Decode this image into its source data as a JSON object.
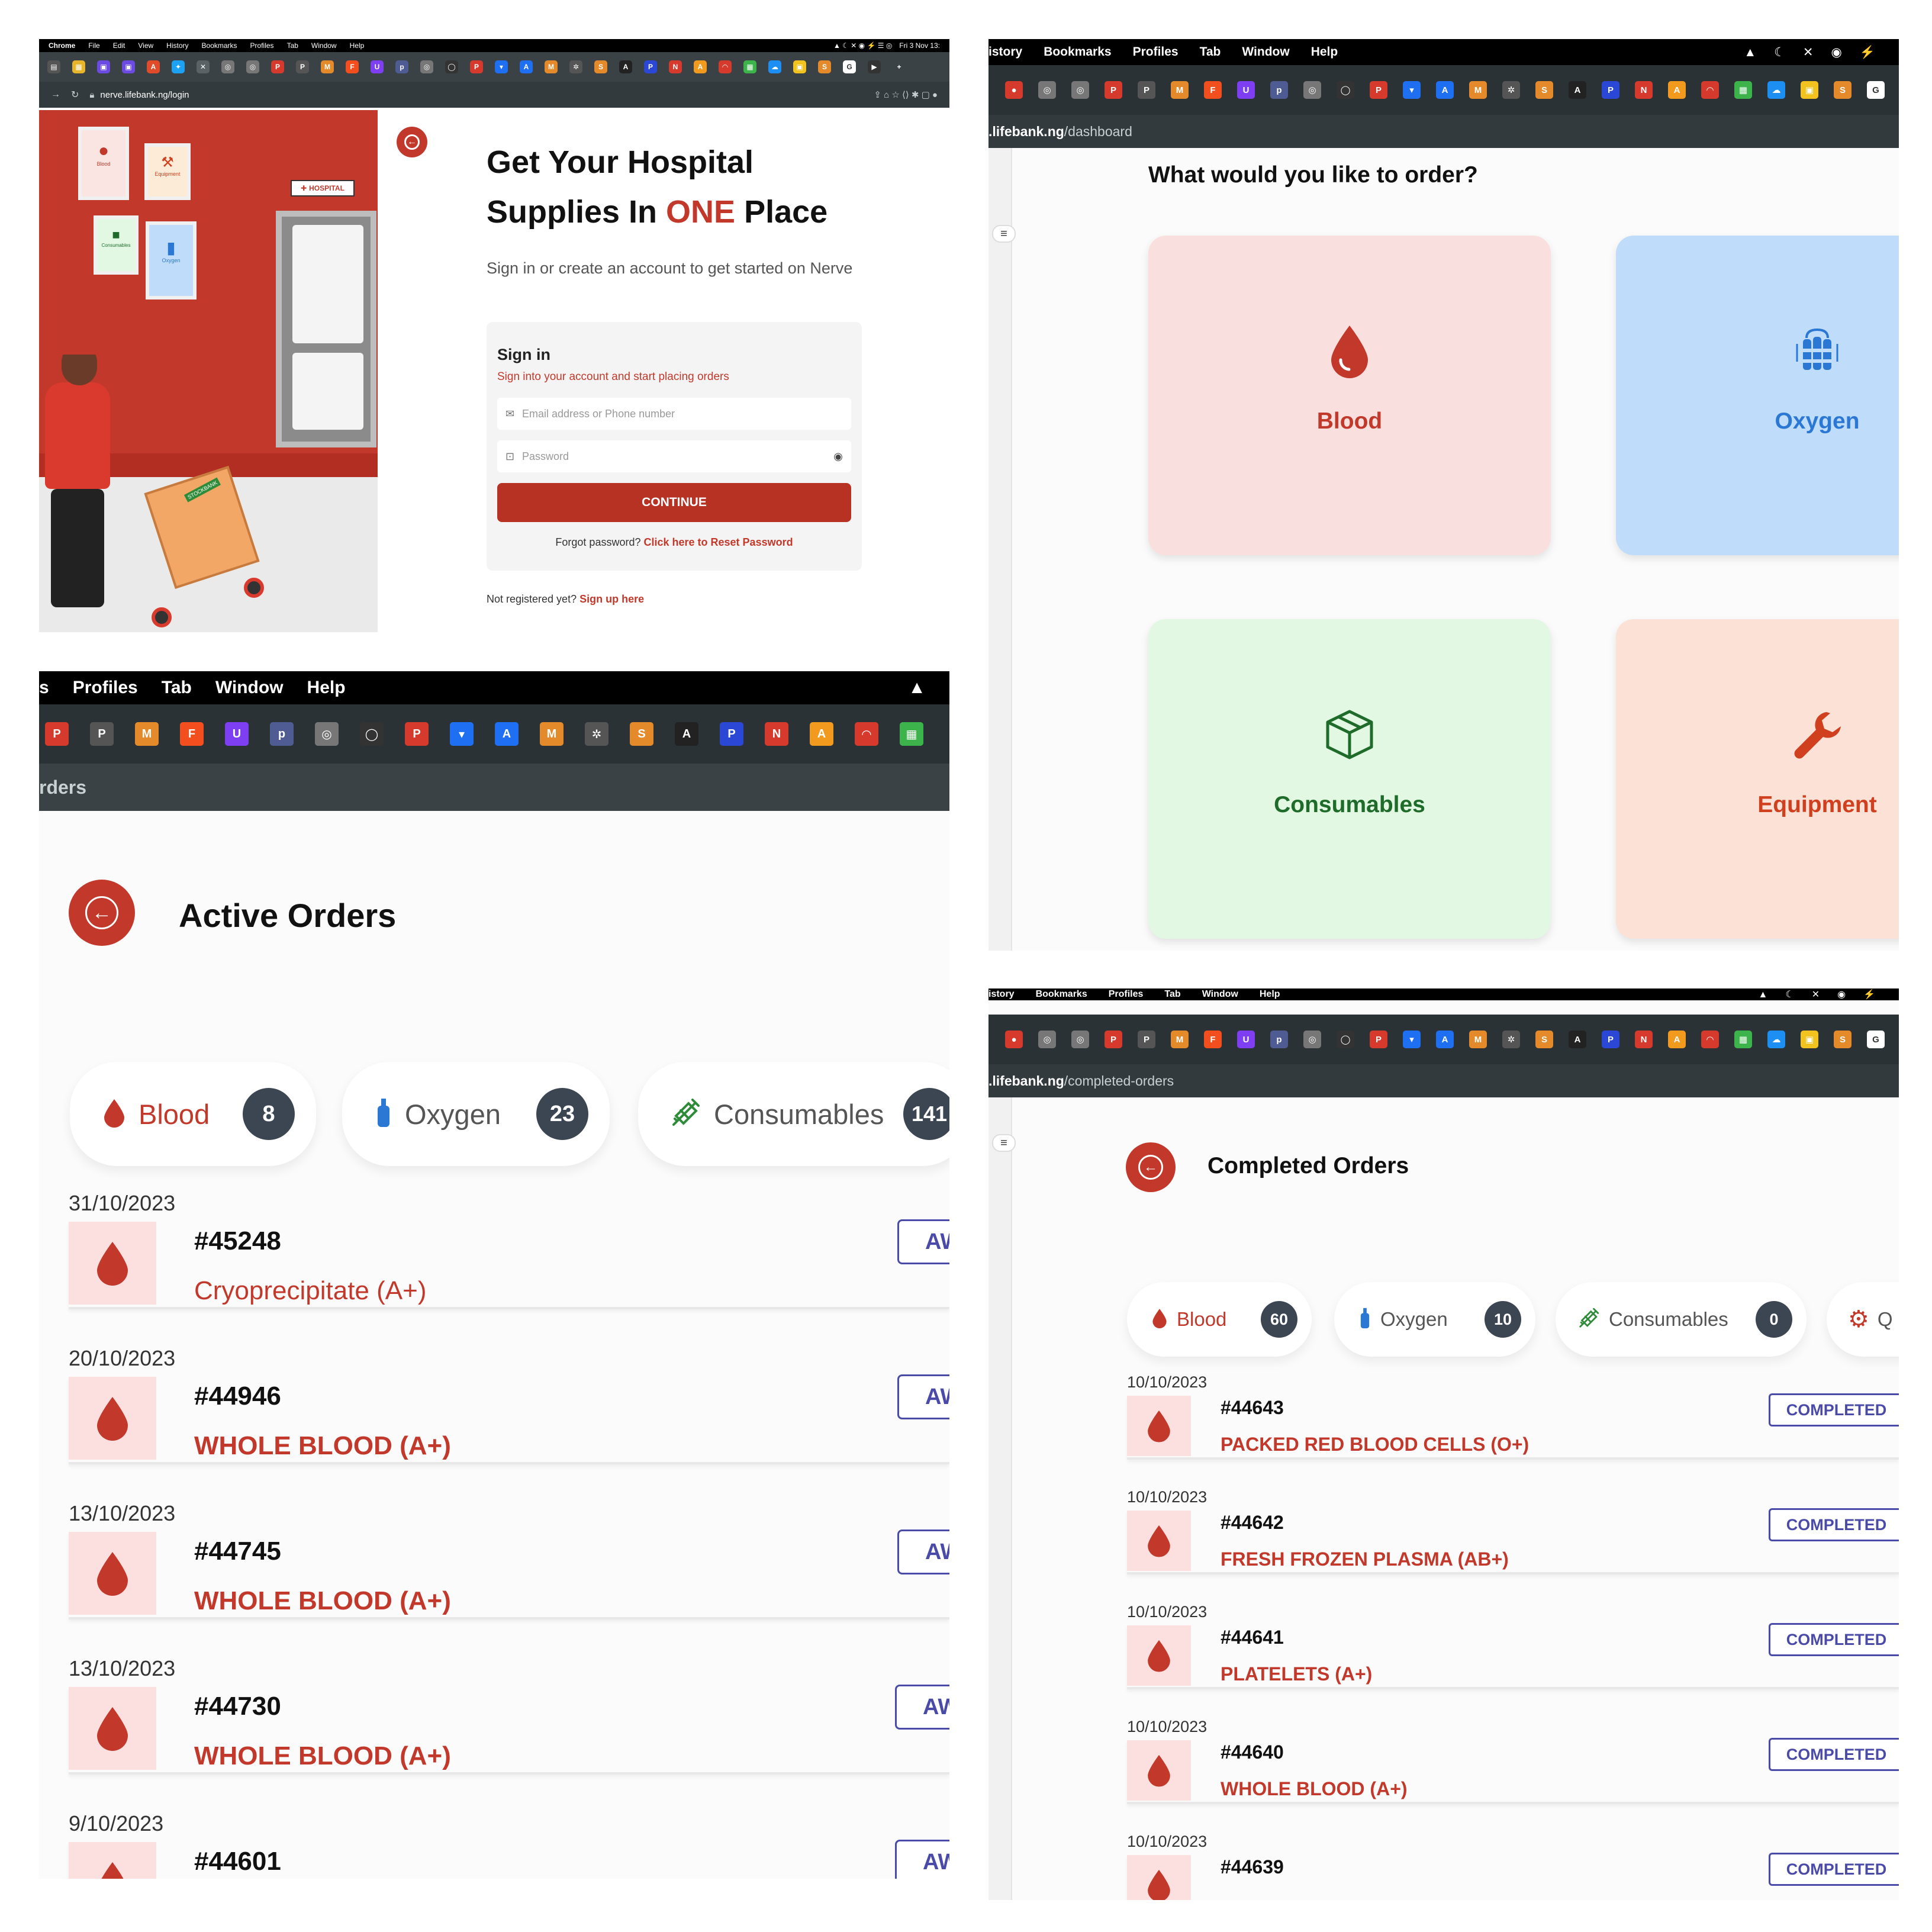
{
  "login": {
    "menubar": [
      "Chrome",
      "File",
      "Edit",
      "View",
      "History",
      "Bookmarks",
      "Profiles",
      "Tab",
      "Window",
      "Help"
    ],
    "clock": "Fri 3 Nov 13:",
    "url": "nerve.lifebank.ng/login",
    "art": {
      "frames": [
        "Blood",
        "Equipment",
        "Consumables",
        "Oxygen"
      ],
      "hospital_sign": "HOSPITAL",
      "box_label": "STOCKBANK"
    },
    "title_line1": "Get Your Hospital",
    "title_line2_pre": "Supplies In ",
    "title_accent": "ONE",
    "title_line2_post": " Place",
    "subtitle": "Sign in or create an account to get started on Nerve",
    "card_title": "Sign in",
    "card_desc": "Sign into your account and start placing orders",
    "email_placeholder": "Email address or Phone number",
    "password_placeholder": "Password",
    "continue_label": "CONTINUE",
    "forgot_text": "Forgot password? ",
    "forgot_link": "Click here to Reset Password",
    "notreg_text": "Not registered yet? ",
    "signup_link": "Sign up here",
    "accent_color": "#c2392b"
  },
  "dashboard": {
    "menubar": [
      "istory",
      "Bookmarks",
      "Profiles",
      "Tab",
      "Window",
      "Help"
    ],
    "url_host": ".lifebank.ng",
    "url_path": "/dashboard",
    "question": "What would you like to order?",
    "categories": [
      {
        "label": "Blood",
        "icon": "blood-drop-icon",
        "bg": "#fadfdf",
        "color": "#c2392b"
      },
      {
        "label": "Oxygen",
        "icon": "oxygen-cylinders-icon",
        "bg": "#bfdcfb",
        "color": "#2a78d4"
      },
      {
        "label": "Consumables",
        "icon": "box-icon",
        "bg": "#e2f8e3",
        "color": "#1f6b2a"
      },
      {
        "label": "Equipment",
        "icon": "wrench-icon",
        "bg": "#fbe1d6",
        "color": "#d0401f"
      }
    ]
  },
  "active": {
    "menubar": [
      "s",
      "Profiles",
      "Tab",
      "Window",
      "Help"
    ],
    "url_fragment": "rders",
    "title": "Active Orders",
    "pills": [
      {
        "label": "Blood",
        "count": "8",
        "icon": "blood-drop-icon",
        "color": "#c2392b"
      },
      {
        "label": "Oxygen",
        "count": "23",
        "icon": "oxygen-icon",
        "color": "#555555"
      },
      {
        "label": "Consumables",
        "count": "141",
        "icon": "syringe-icon",
        "color": "#555555"
      }
    ],
    "orders": [
      {
        "date": "31/10/2023",
        "id": "#45248",
        "name": "Cryoprecipitate (A+)",
        "status": "AWA"
      },
      {
        "date": "20/10/2023",
        "id": "#44946",
        "name": "WHOLE BLOOD (A+)",
        "status": "AWA"
      },
      {
        "date": "13/10/2023",
        "id": "#44745",
        "name": "WHOLE BLOOD (A+)",
        "status": "AWA"
      },
      {
        "date": "13/10/2023",
        "id": "#44730",
        "name": "WHOLE BLOOD (A+)",
        "status": "AWAI"
      },
      {
        "date": "9/10/2023",
        "id": "#44601",
        "name": "",
        "status": "AWAI"
      }
    ]
  },
  "completed": {
    "menubar": [
      "istory",
      "Bookmarks",
      "Profiles",
      "Tab",
      "Window",
      "Help"
    ],
    "url_host": ".lifebank.ng",
    "url_path": "/completed-orders",
    "title": "Completed Orders",
    "pills": [
      {
        "label": "Blood",
        "count": "60",
        "icon": "blood-drop-icon",
        "color": "#c2392b"
      },
      {
        "label": "Oxygen",
        "count": "10",
        "icon": "oxygen-icon",
        "color": "#555555"
      },
      {
        "label": "Consumables",
        "count": "0",
        "icon": "syringe-icon",
        "color": "#555555"
      },
      {
        "label": "Q",
        "count": "",
        "icon": "gear-icon",
        "color": "#c2392b"
      }
    ],
    "orders": [
      {
        "date": "10/10/2023",
        "id": "#44643",
        "name": "PACKED RED BLOOD CELLS (O+)",
        "status": "COMPLETED"
      },
      {
        "date": "10/10/2023",
        "id": "#44642",
        "name": "FRESH FROZEN PLASMA (AB+)",
        "status": "COMPLETED"
      },
      {
        "date": "10/10/2023",
        "id": "#44641",
        "name": "PLATELETS (A+)",
        "status": "COMPLETED"
      },
      {
        "date": "10/10/2023",
        "id": "#44640",
        "name": "WHOLE BLOOD (A+)",
        "status": "COMPLETED"
      },
      {
        "date": "10/10/2023",
        "id": "#44639",
        "name": "",
        "status": "COMPLETED"
      }
    ]
  }
}
